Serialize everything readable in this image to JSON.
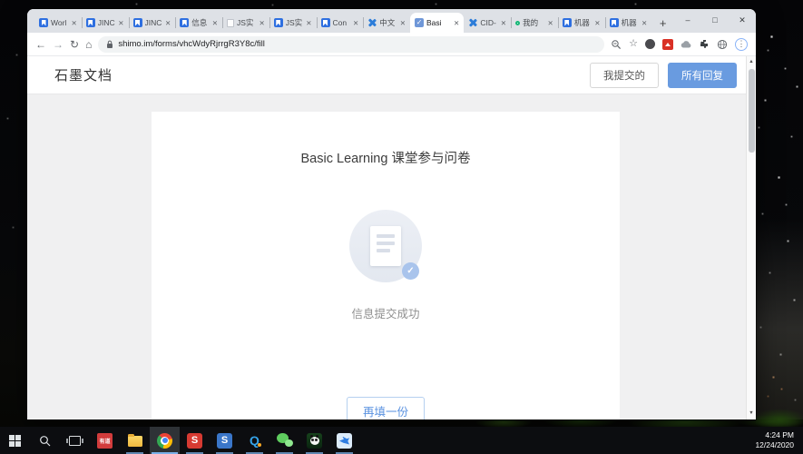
{
  "browser": {
    "tabs": [
      {
        "label": "Worl"
      },
      {
        "label": "JINC"
      },
      {
        "label": "JINC"
      },
      {
        "label": "信息"
      },
      {
        "label": "JS实"
      },
      {
        "label": "JS实"
      },
      {
        "label": "Con"
      },
      {
        "label": "中文"
      },
      {
        "label": "Basi"
      },
      {
        "label": "CID-"
      },
      {
        "label": "我的"
      },
      {
        "label": "机器"
      },
      {
        "label": "机器"
      }
    ],
    "tab_close_glyph": "✕",
    "new_tab_glyph": "+",
    "window_controls": {
      "minimize": "–",
      "maximize": "□",
      "close": "✕"
    },
    "nav": {
      "back": "←",
      "forward": "→",
      "reload": "↻",
      "home": "⌂"
    },
    "address": "shimo.im/forms/vhcWdyRjrrgR3Y8c/fill",
    "star_glyph": "☆",
    "menu_glyph": "⋮"
  },
  "page": {
    "brand": "石墨文档",
    "my_submissions_button": "我提交的",
    "all_responses_button": "所有回复",
    "form_title": "Basic Learning 课堂参与问卷",
    "success_message": "信息提交成功",
    "refill_button": "再填一份",
    "check_glyph": "✓"
  },
  "scrollbar": {
    "up": "▲",
    "down": "▼"
  },
  "taskbar": {
    "youdao_label": "有道",
    "s_red_label": "S",
    "s_blue_label": "S",
    "q_label": "Q",
    "clock_time": "4:24 PM",
    "clock_date": "12/24/2020"
  },
  "colors": {
    "accent_blue": "#699be0",
    "shimo_blue": "#2e6fe0",
    "success_badge": "#a9c4ec"
  }
}
